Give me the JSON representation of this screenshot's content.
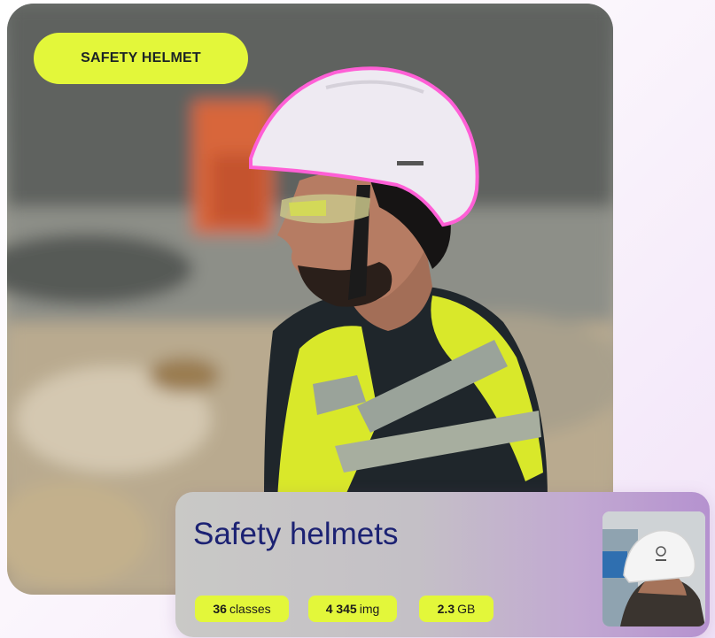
{
  "photo": {
    "tag_label": "SAFETY HELMET"
  },
  "dataset_card": {
    "title": "Safety helmets",
    "stats": {
      "classes_value": "36",
      "classes_unit": "classes",
      "images_value": "4 345",
      "images_unit": "img",
      "size_value": "2.3",
      "size_unit": "GB"
    }
  },
  "colors": {
    "accent": "#e3f73a",
    "title_text": "#1c2273",
    "helmet_outline": "#ff5fd6"
  }
}
